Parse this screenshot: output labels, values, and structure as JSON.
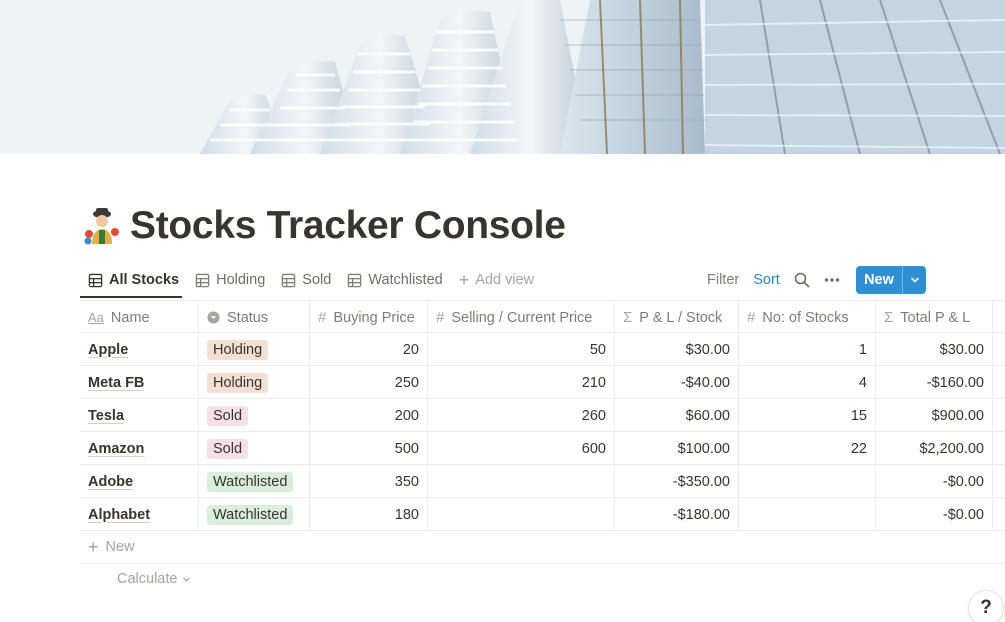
{
  "page": {
    "title": "Stocks Tracker Console",
    "icon": "person-juggling-icon"
  },
  "tabs": [
    {
      "label": "All Stocks",
      "icon": "table-icon",
      "active": true
    },
    {
      "label": "Holding",
      "icon": "table-icon",
      "active": false
    },
    {
      "label": "Sold",
      "icon": "table-icon",
      "active": false
    },
    {
      "label": "Watchlisted",
      "icon": "table-icon",
      "active": false
    }
  ],
  "add_view_label": "Add view",
  "toolbar": {
    "filter_label": "Filter",
    "sort_label": "Sort",
    "search_icon": "search-icon",
    "more_icon": "more-horizontal-icon",
    "new_label": "New",
    "new_button_color": "#2e8fd5",
    "sort_color": "#2e86c9"
  },
  "columns": [
    {
      "label": "Name",
      "icon": "text-aa-icon"
    },
    {
      "label": "Status",
      "icon": "select-icon"
    },
    {
      "label": "Buying Price",
      "icon": "number-icon"
    },
    {
      "label": "Selling / Current Price",
      "icon": "number-icon"
    },
    {
      "label": "P & L / Stock",
      "icon": "formula-sigma-icon"
    },
    {
      "label": "No: of Stocks",
      "icon": "number-icon"
    },
    {
      "label": "Total P & L",
      "icon": "formula-sigma-icon"
    }
  ],
  "status_colors": {
    "Holding": "#f4dfd3",
    "Sold": "#f5e0e9",
    "Watchlisted": "#dbeddb"
  },
  "rows": [
    {
      "name": "Apple",
      "status": "Holding",
      "buy": "20",
      "sell": "50",
      "pl": "$30.00",
      "qty": "1",
      "total": "$30.00"
    },
    {
      "name": "Meta FB",
      "status": "Holding",
      "buy": "250",
      "sell": "210",
      "pl": "-$40.00",
      "qty": "4",
      "total": "-$160.00"
    },
    {
      "name": "Tesla",
      "status": "Sold",
      "buy": "200",
      "sell": "260",
      "pl": "$60.00",
      "qty": "15",
      "total": "$900.00"
    },
    {
      "name": "Amazon",
      "status": "Sold",
      "buy": "500",
      "sell": "600",
      "pl": "$100.00",
      "qty": "22",
      "total": "$2,200.00"
    },
    {
      "name": "Adobe",
      "status": "Watchlisted",
      "buy": "350",
      "sell": "",
      "pl": "-$350.00",
      "qty": "",
      "total": "-$0.00"
    },
    {
      "name": "Alphabet",
      "status": "Watchlisted",
      "buy": "180",
      "sell": "",
      "pl": "-$180.00",
      "qty": "",
      "total": "-$0.00"
    }
  ],
  "new_row_label": "New",
  "calculate_label": "Calculate",
  "help_label": "?"
}
